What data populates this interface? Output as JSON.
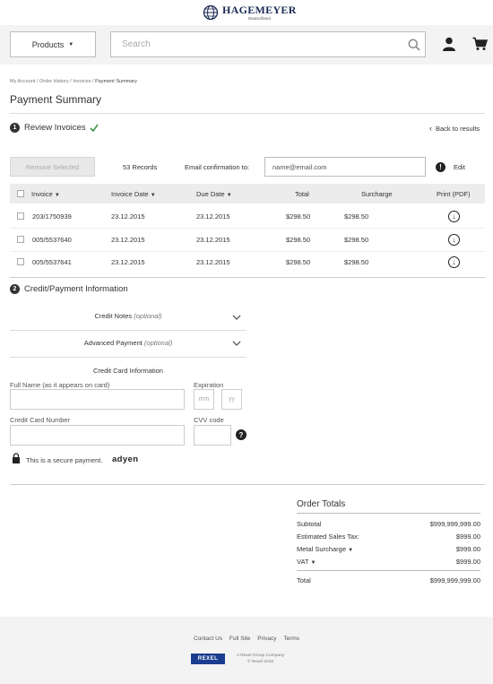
{
  "header": {
    "brand": "HAGEMEYER",
    "brand_sub": "Deutschland",
    "products_label": "Products",
    "search_placeholder": "Search"
  },
  "breadcrumb": [
    "My Account",
    "Order History",
    "Invoices",
    "Payment Summary"
  ],
  "page_title": "Payment Summary",
  "review": {
    "step": "1",
    "heading": "Review Invoices",
    "back_link": "Back to results",
    "remove_label": "Remove Selected",
    "records": "53 Records",
    "email_label": "Email confirmation to:",
    "email_placeholder": "name@email.com",
    "edit_label": "Edit",
    "columns": [
      "Invoice",
      "Invoice Date",
      "Due Date",
      "Total",
      "Surcharge",
      "Print (PDF)"
    ],
    "rows": [
      {
        "invoice": "203/1750939",
        "invoice_date": "23.12.2015",
        "due_date": "23.12.2015",
        "total": "$298.50",
        "surcharge": "$298.50"
      },
      {
        "invoice": "005/5537640",
        "invoice_date": "23.12.2015",
        "due_date": "23.12.2015",
        "total": "$298.50",
        "surcharge": "$298.50"
      },
      {
        "invoice": "005/5537641",
        "invoice_date": "23.12.2015",
        "due_date": "23.12.2015",
        "total": "$298.50",
        "surcharge": "$298.50"
      }
    ]
  },
  "payment": {
    "step": "2",
    "heading": "Credit/Payment Information",
    "credit_notes": "Credit Notes",
    "advanced_payment": "Advanced Payment",
    "optional": "(optional)",
    "cc_title": "Credit Card Information",
    "full_name_label": "Full Name (as it appears on card)",
    "expiration_label": "Expiration",
    "mm_placeholder": "mm",
    "yy_placeholder": "yy",
    "cc_number_label": "Credit Card Number",
    "cvv_label": "CVV code",
    "secure_text": "This is a secure payment.",
    "adyen": "adyen"
  },
  "totals": {
    "title": "Order Totals",
    "subtotal_label": "Subtotal",
    "subtotal": "$999,999,999.00",
    "tax_label": "Estimated Sales Tax:",
    "tax": "$999.00",
    "metal_label": "Metal Surcharge",
    "metal": "$999.00",
    "vat_label": "VAT",
    "vat": "$999.00",
    "total_label": "Total",
    "total": "$999,999,999.00"
  },
  "footer": {
    "links": [
      "Contact Us",
      "Full Site",
      "Privacy",
      "Terms"
    ],
    "rexel": "REXEL",
    "company_line": "A Rexel Group Company",
    "copyright": "© Rexel 2015"
  },
  "colors": {
    "link": "#1d5fa6",
    "check_green": "#2e8b3a",
    "brand_navy": "#1a2a55",
    "rexel_blue": "#1a3d8f"
  }
}
